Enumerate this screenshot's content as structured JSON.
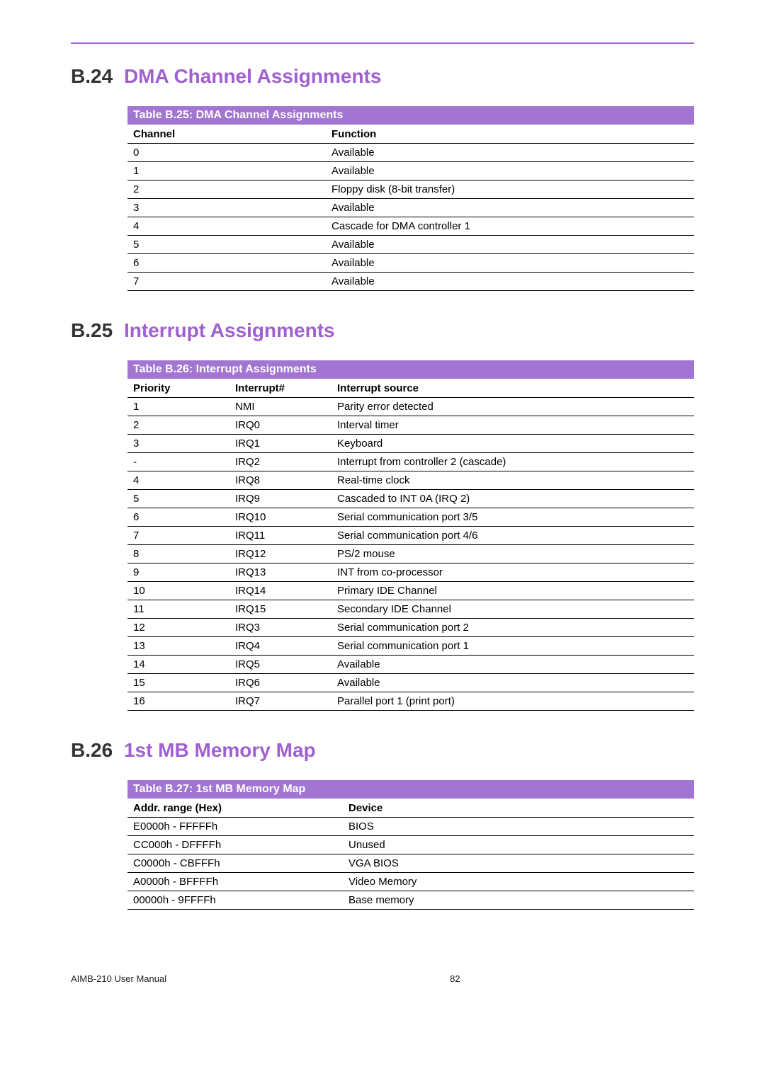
{
  "sections": {
    "b24": {
      "num": "B.24",
      "title": "DMA Channel Assignments"
    },
    "b25": {
      "num": "B.25",
      "title": "Interrupt Assignments"
    },
    "b26": {
      "num": "B.26",
      "title": "1st MB Memory Map"
    }
  },
  "tables": {
    "dma": {
      "caption": "Table B.25: DMA Channel Assignments",
      "headers": {
        "channel": "Channel",
        "function": "Function"
      },
      "rows": [
        {
          "channel": "0",
          "function": "Available"
        },
        {
          "channel": "1",
          "function": "Available"
        },
        {
          "channel": "2",
          "function": "Floppy disk (8-bit transfer)"
        },
        {
          "channel": "3",
          "function": "Available"
        },
        {
          "channel": "4",
          "function": "Cascade for DMA controller 1"
        },
        {
          "channel": "5",
          "function": "Available"
        },
        {
          "channel": "6",
          "function": "Available"
        },
        {
          "channel": "7",
          "function": "Available"
        }
      ]
    },
    "irq": {
      "caption": "Table B.26: Interrupt Assignments",
      "headers": {
        "priority": "Priority",
        "interrupt": "Interrupt#",
        "source": "Interrupt source"
      },
      "rows": [
        {
          "priority": "1",
          "interrupt": "NMI",
          "source": "Parity error detected"
        },
        {
          "priority": "2",
          "interrupt": "IRQ0",
          "source": "Interval timer"
        },
        {
          "priority": "3",
          "interrupt": "IRQ1",
          "source": "Keyboard"
        },
        {
          "priority": "-",
          "interrupt": "IRQ2",
          "source": "Interrupt from controller 2 (cascade)"
        },
        {
          "priority": "4",
          "interrupt": "IRQ8",
          "source": "Real-time clock"
        },
        {
          "priority": "5",
          "interrupt": "IRQ9",
          "source": "Cascaded to INT 0A (IRQ 2)"
        },
        {
          "priority": "6",
          "interrupt": "IRQ10",
          "source": "Serial communication port 3/5"
        },
        {
          "priority": "7",
          "interrupt": "IRQ11",
          "source": "Serial communication port 4/6"
        },
        {
          "priority": "8",
          "interrupt": "IRQ12",
          "source": "PS/2 mouse"
        },
        {
          "priority": "9",
          "interrupt": "IRQ13",
          "source": "INT from co-processor"
        },
        {
          "priority": "10",
          "interrupt": "IRQ14",
          "source": "Primary IDE Channel"
        },
        {
          "priority": "11",
          "interrupt": "IRQ15",
          "source": "Secondary IDE Channel"
        },
        {
          "priority": "12",
          "interrupt": "IRQ3",
          "source": "Serial communication port 2"
        },
        {
          "priority": "13",
          "interrupt": "IRQ4",
          "source": "Serial communication port 1"
        },
        {
          "priority": "14",
          "interrupt": "IRQ5",
          "source": "Available"
        },
        {
          "priority": "15",
          "interrupt": "IRQ6",
          "source": "Available"
        },
        {
          "priority": "16",
          "interrupt": "IRQ7",
          "source": "Parallel port 1 (print port)"
        }
      ]
    },
    "mem": {
      "caption": "Table B.27: 1st MB Memory Map",
      "headers": {
        "addr": "Addr. range (Hex)",
        "device": "Device"
      },
      "rows": [
        {
          "addr": "E0000h - FFFFFh",
          "device": "BIOS"
        },
        {
          "addr": "CC000h - DFFFFh",
          "device": "Unused"
        },
        {
          "addr": "C0000h - CBFFFh",
          "device": "VGA BIOS"
        },
        {
          "addr": "A0000h - BFFFFh",
          "device": "Video Memory"
        },
        {
          "addr": "00000h - 9FFFFh",
          "device": "Base memory"
        }
      ]
    }
  },
  "footer": {
    "manual": "AIMB-210 User Manual",
    "page": "82"
  }
}
